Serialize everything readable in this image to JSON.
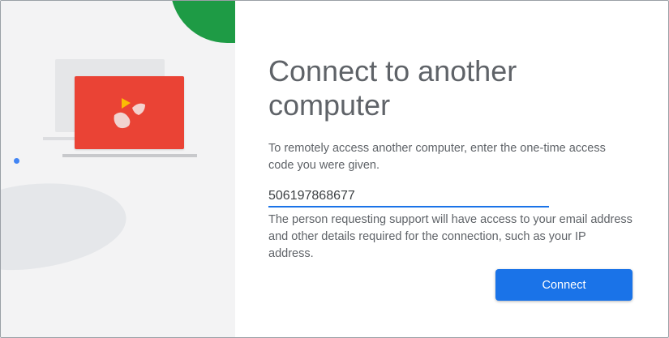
{
  "dialog": {
    "title": "Connect to another computer",
    "instructions": "To remotely access another computer, enter the one-time access code you were given.",
    "access_code": {
      "value": "506197868677",
      "placeholder": ""
    },
    "notice": "The person requesting support will have access to your email address and other details required for the connection, such as your IP address.",
    "connect_label": "Connect"
  },
  "illustration": {
    "icon": "remote-desktop-logo-icon",
    "colors": {
      "screen": "#ea4335",
      "accent_green": "#1e9b45",
      "dot_blue": "#4285f4",
      "arrow_yellow": "#fbbc04"
    }
  },
  "colors": {
    "primary": "#1a73e8",
    "text": "#5f6368"
  }
}
